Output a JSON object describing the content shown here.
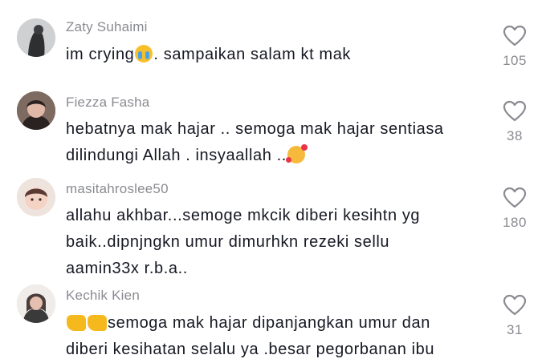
{
  "comments": [
    {
      "username": "Zaty Suhaimi",
      "emoji_lead": "",
      "line1_a": "im crying",
      "line1_emoji": "loudly-crying-face-icon",
      "line1_b": ". sampaikan salam kt mak",
      "line2": "",
      "line3": "",
      "likes": "105",
      "avatar_color": "#3d3f42"
    },
    {
      "username": "Fiezza Fasha",
      "line1": "hebatnya mak hajar .. semoga mak hajar sentiasa",
      "line2_a": "dilindungi Allah . insyaallah ..",
      "line2_emoji": "smiling-face-with-hearts-icon",
      "likes": "38",
      "avatar_color": "#5a4a44"
    },
    {
      "username": "masitahroslee50",
      "line1": "allahu akhbar...semoge mkcik diberi kesihtn yg",
      "line2": "baik..dipnjngkn umur dimurhkn rezeki sellu",
      "line3": "aamin33x r.b.a..",
      "likes": "180",
      "avatar_color": "#e9d6cf"
    },
    {
      "username": "Kechik Kien",
      "line1_emoji": "flexed-biceps-icon",
      "line1_b": "semoga mak hajar dipanjangkan umur dan",
      "line2": "diberi kesihatan selalu ya .besar pegorbanan ibu",
      "likes": "31",
      "avatar_color": "#c9a9a0"
    }
  ],
  "colors": {
    "text": "#161823",
    "muted": "#8a8b91",
    "heart": "#8a8b91"
  }
}
